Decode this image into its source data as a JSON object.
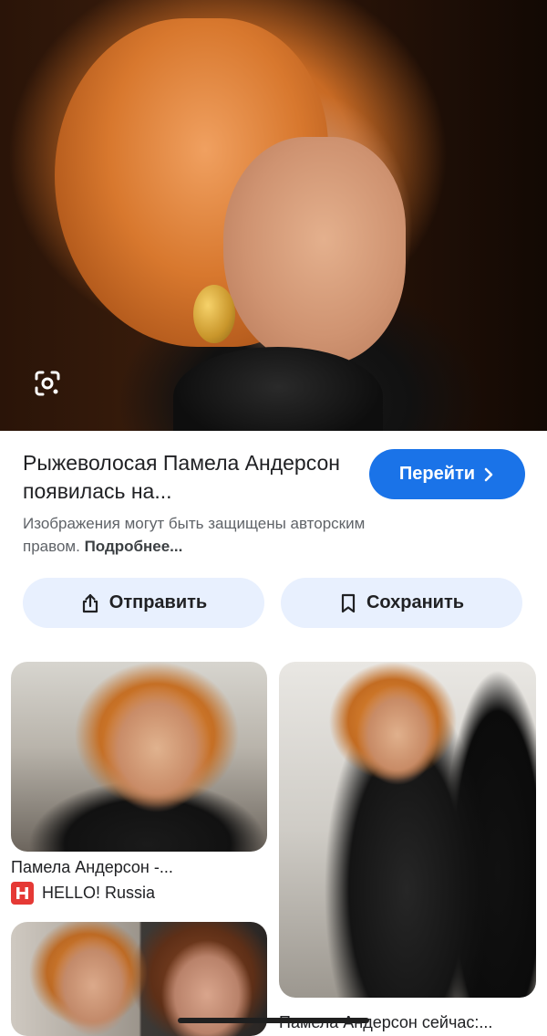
{
  "result": {
    "title": "Рыжеволосая Памела Андерсон появилась на...",
    "visit_label": "Перейти",
    "copyright_text": "Изображения могут быть защищены авторским правом.",
    "more_link": "Подробнее..."
  },
  "actions": {
    "share_label": "Отправить",
    "save_label": "Сохранить"
  },
  "related": [
    {
      "title": "Памела Андерсон -...",
      "source": "HELLO! Russia"
    },
    {
      "title": "Памела Андерсон сейчас:..."
    }
  ],
  "colors": {
    "accent": "#1a73e8",
    "action_bg": "#e8f0fe",
    "favicon": "#e53935"
  },
  "icons": [
    "google-lens-icon",
    "chevron-right-icon",
    "share-icon",
    "bookmark-icon",
    "hello-favicon"
  ]
}
